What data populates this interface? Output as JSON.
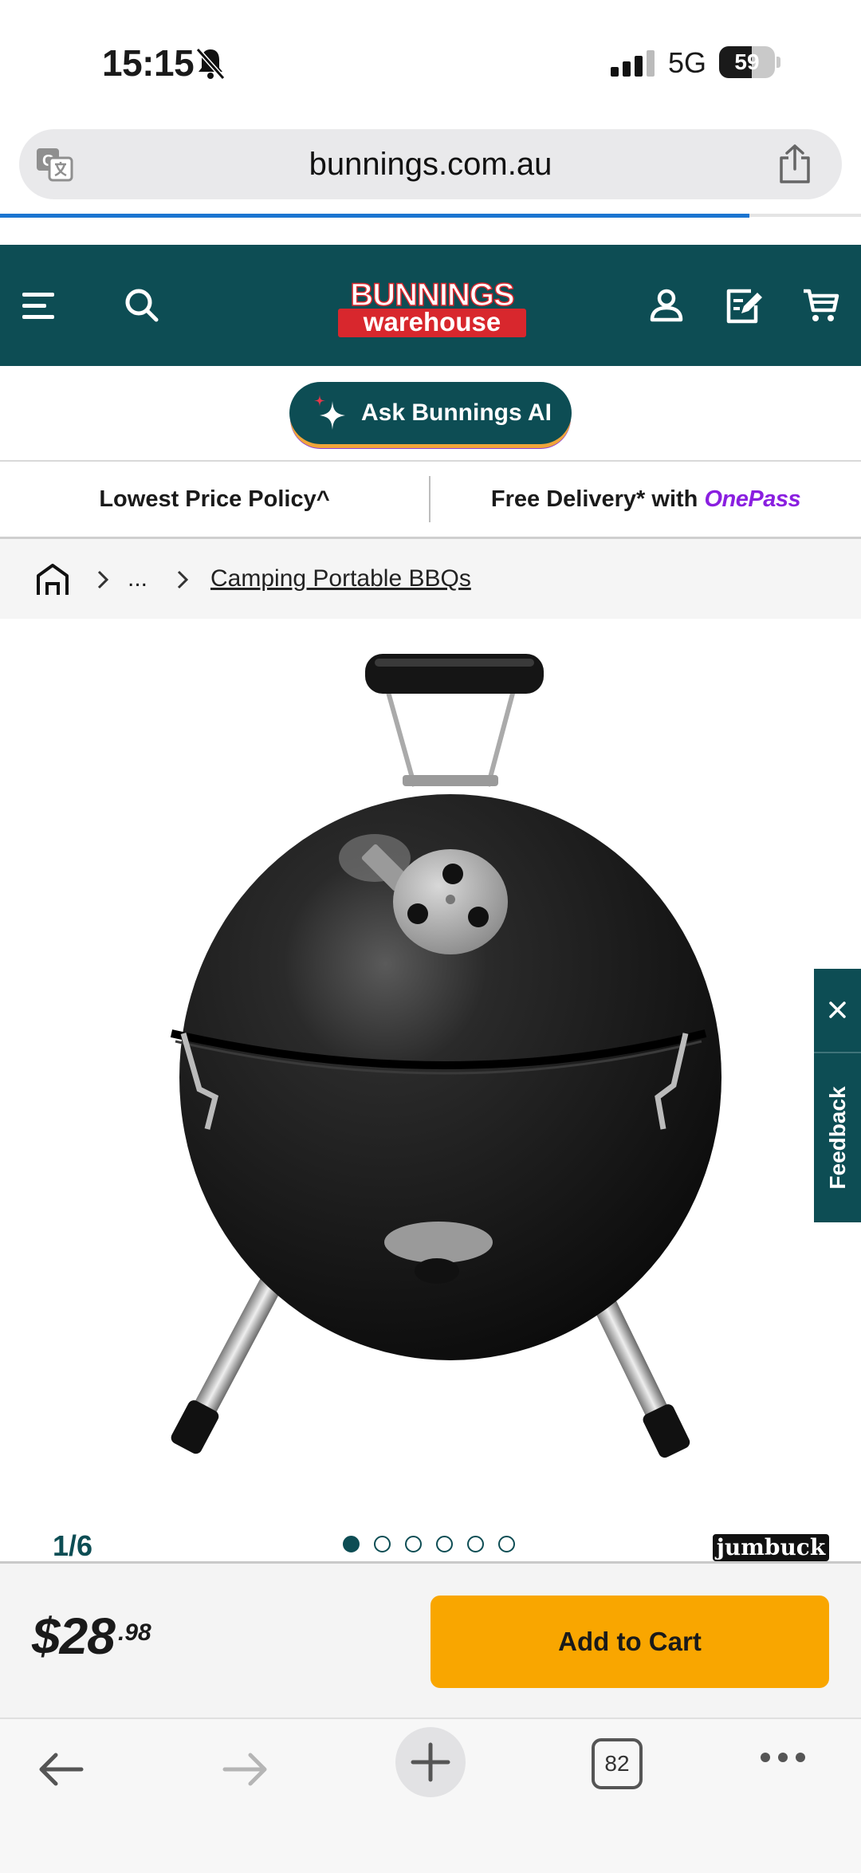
{
  "status_bar": {
    "time": "15:15",
    "network": "5G",
    "battery_level": 59,
    "battery_label": "59"
  },
  "browser": {
    "url": "bunnings.com.au",
    "tab_count": "82",
    "load_progress_percent": 87
  },
  "header": {
    "logo_line1": "BUNNINGS",
    "logo_line2": "warehouse"
  },
  "ai": {
    "button_label": "Ask Bunnings AI"
  },
  "promo": {
    "left_text": "Lowest Price Policy^",
    "right_prefix": "Free Delivery* with ",
    "right_brand": "OnePass"
  },
  "breadcrumb": {
    "ellipsis": "...",
    "current": "Camping Portable BBQs"
  },
  "gallery": {
    "counter": "1/6",
    "total_images": 6,
    "active_index": 0,
    "brand": "jumbuck"
  },
  "feedback": {
    "label": "Feedback",
    "close": "×"
  },
  "purchase": {
    "price_main": "$28",
    "price_cents": ".98",
    "add_to_cart": "Add to Cart"
  },
  "colors": {
    "brand_green": "#0d4d54",
    "cta_orange": "#f9a600",
    "onepass_purple": "#8a1fe0",
    "progress_blue": "#1b75d0"
  }
}
